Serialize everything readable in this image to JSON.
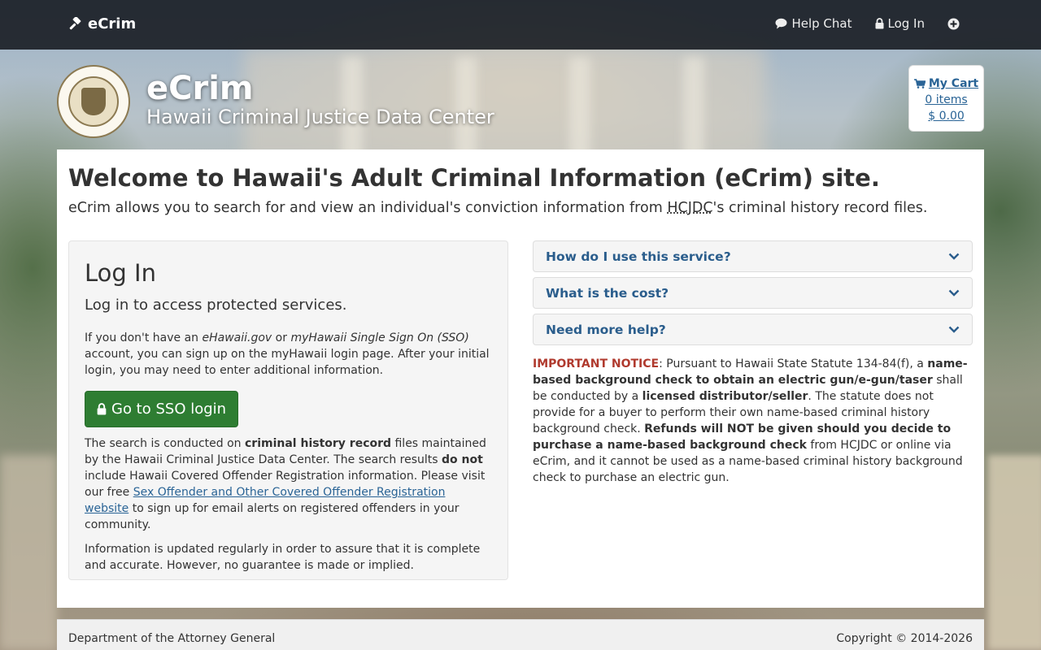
{
  "navbar": {
    "brand": "eCrim",
    "help_chat": "Help Chat",
    "login": "Log In"
  },
  "header": {
    "title": "eCrim",
    "subtitle": "Hawaii Criminal Justice Data Center"
  },
  "cart": {
    "title": "My Cart",
    "items": "0 items",
    "total": "$ 0.00"
  },
  "main": {
    "welcome": "Welcome to Hawaii's Adult Criminal Information (eCrim) site.",
    "lead_before": "eCrim allows you to search for and view an individual's conviction information from ",
    "lead_abbr": "HCJDC",
    "lead_after": "'s criminal history record files."
  },
  "login": {
    "title": "Log In",
    "subtitle": "Log in to access protected services.",
    "p1_a": "If you don't have an ",
    "p1_em1": "eHawaii.gov",
    "p1_b": " or ",
    "p1_em2": "myHawaii Single Sign On (SSO)",
    "p1_c": " account, you can sign up on the myHawaii login page. After your initial login, you may need to enter additional information.",
    "sso_button": "Go to SSO login",
    "p2_a": "The search is conducted on ",
    "p2_b1": "criminal history record",
    "p2_b": " files maintained by the Hawaii Criminal Justice Data Center. The search results ",
    "p2_b2": "do not",
    "p2_c": " include Hawaii Covered Offender Registration information. Please visit our free ",
    "p2_link": "Sex Offender and Other Covered Offender Registration website",
    "p2_d": " to sign up for email alerts on registered offenders in your community.",
    "p3": "Information is updated regularly in order to assure that it is complete and accurate. However, no guarantee is made or implied."
  },
  "accordion": [
    {
      "label": "How do I use this service?"
    },
    {
      "label": "What is the cost?"
    },
    {
      "label": "Need more help?"
    }
  ],
  "notice": {
    "label": "IMPORTANT NOTICE",
    "t1": ": Pursuant to Hawaii State Statute 134-84(f), a ",
    "b1": "name-based background check to obtain an electric gun/e-gun/taser",
    "t2": " shall be conducted by a ",
    "b2": "licensed distributor/seller",
    "t3": ". The statute does not provide for a buyer to perform their own name-based criminal history background check. ",
    "b3": "Refunds will NOT be given should you decide to purchase a name-based background check",
    "t4": " from HCJDC or online via eCrim, and it cannot be used as a name-based criminal history background check to purchase an electric gun."
  },
  "footer": {
    "left": "Department of the Attorney General",
    "right": "Copyright © 2014-2026"
  },
  "colors": {
    "accent": "#2a5d8c",
    "sso_button": "#2e7d32",
    "notice_red": "#b03a2e"
  },
  "icons": {
    "brand": "gavel-icon",
    "help": "comment-icon",
    "login": "lock-icon",
    "more": "plus-circle-icon",
    "cart": "cart-icon",
    "accordion": "chevron-down-icon"
  }
}
